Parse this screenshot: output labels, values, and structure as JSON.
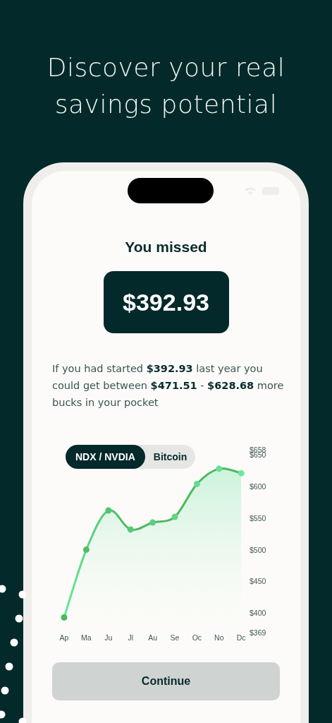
{
  "headline": "Discover your real savings potential",
  "title": "You missed",
  "amount": "$392.93",
  "message": "If you had started **$392.93** last year you could get between **$471.51** - **$628.68** more bucks in your pocket",
  "tabs": [
    {
      "label": "NDX / NVDIA",
      "selected": true
    },
    {
      "label": "Bitcoin",
      "selected": false
    }
  ],
  "chart_data": {
    "type": "area",
    "categories": [
      "Ap",
      "Ma",
      "Ju",
      "Jl",
      "Au",
      "Se",
      "Oc",
      "No",
      "Dc"
    ],
    "series": [
      {
        "color": "#4cb860",
        "values": [
          393,
          500,
          562,
          532,
          543,
          552,
          604,
          628,
          621
        ]
      }
    ],
    "ylim": [
      369,
      658
    ],
    "yticks": [
      {
        "value": 369,
        "label": "$369"
      },
      {
        "value": 400,
        "label": "$400"
      },
      {
        "value": 450,
        "label": "$450"
      },
      {
        "value": 500,
        "label": "$500"
      },
      {
        "value": 550,
        "label": "$550"
      },
      {
        "value": 600,
        "label": "$600"
      },
      {
        "value": 650,
        "label": "$650"
      },
      {
        "value": 658,
        "label": "$658"
      }
    ]
  },
  "button": "Continue"
}
